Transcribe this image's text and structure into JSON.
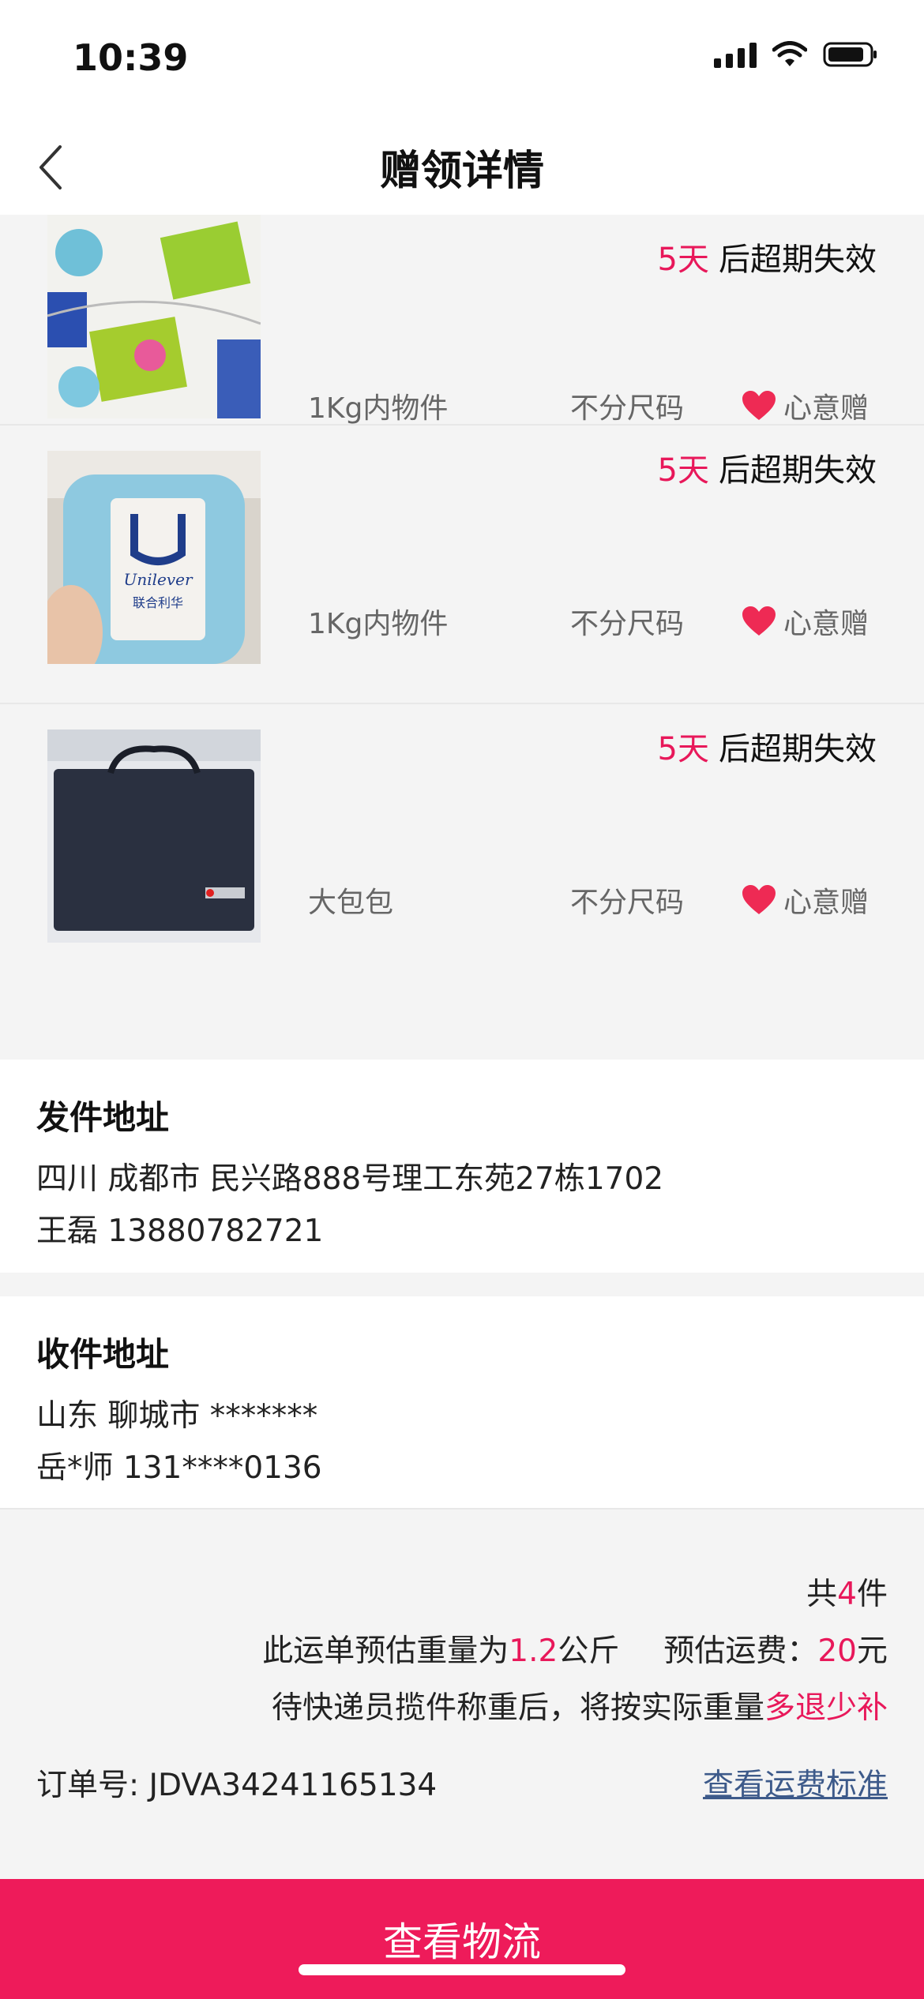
{
  "status_bar": {
    "time": "10:39",
    "icons": [
      "signal-icon",
      "wifi-icon",
      "battery-icon"
    ]
  },
  "nav": {
    "title": "赠领详情",
    "back_icon": "chevron-left-icon"
  },
  "items": [
    {
      "expiry_days": "5天",
      "expiry_text": "后超期失效",
      "name": "1Kg内物件",
      "size": "不分尺码",
      "tag": "心意赠",
      "thumb_icon": "quilt-photo"
    },
    {
      "expiry_days": "5天",
      "expiry_text": "后超期失效",
      "name": "1Kg内物件",
      "size": "不分尺码",
      "tag": "心意赠",
      "thumb_icon": "towel-photo"
    },
    {
      "expiry_days": "5天",
      "expiry_text": "后超期失效",
      "name": "大包包",
      "size": "不分尺码",
      "tag": "心意赠",
      "thumb_icon": "bag-photo"
    }
  ],
  "sender": {
    "title": "发件地址",
    "address": "四川 成都市 民兴路888号理工东苑27栋1702",
    "contact": "王磊 13880782721"
  },
  "receiver": {
    "title": "收件地址",
    "address": "山东 聊城市 *******",
    "contact": "岳*师 131****0136"
  },
  "summary": {
    "count_prefix": "共",
    "count": "4",
    "count_suffix": "件",
    "weight_prefix": "此运单预估重量为",
    "weight": "1.2",
    "weight_unit": "公斤",
    "fee_label": "预估运费：",
    "fee": "20",
    "fee_unit": "元",
    "note_prefix": "待快递员揽件称重后，将按实际重量",
    "note_highlight": "多退少补",
    "order_label": "订单号:",
    "order_no": "JDVA34241165134",
    "fee_link": "查看运费标准"
  },
  "cta": {
    "label": "查看物流"
  },
  "colors": {
    "accent": "#ee1b5a",
    "link": "#3d5a8a"
  }
}
